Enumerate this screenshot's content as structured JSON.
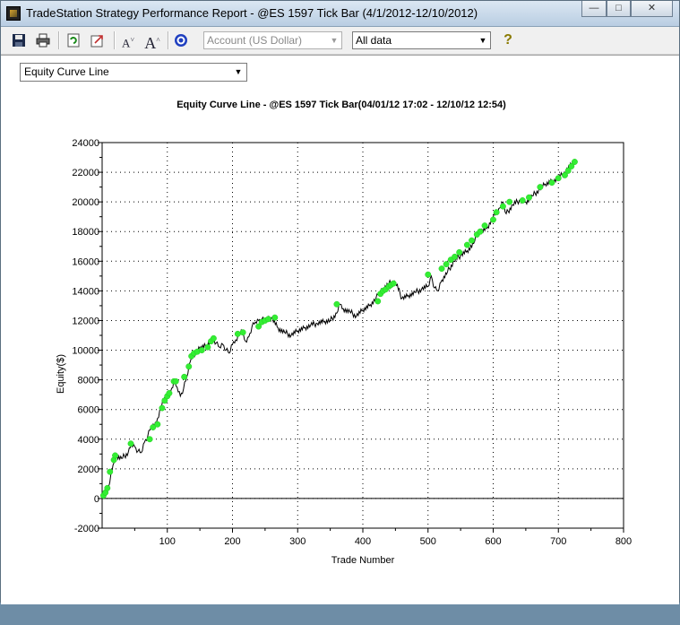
{
  "window": {
    "title": "TradeStation Strategy Performance Report - @ES 1597 Tick Bar (4/1/2012-12/10/2012)",
    "controls": {
      "minimize": "—",
      "maximize": "□",
      "close": "✕"
    }
  },
  "toolbar": {
    "icons": [
      "save-icon",
      "print-icon",
      "refresh-icon",
      "export-icon",
      "decrease-font-icon",
      "increase-font-icon",
      "target-icon",
      "help-icon"
    ],
    "account_select": {
      "value": "Account (US Dollar)",
      "disabled": true
    },
    "data_select": {
      "value": "All data"
    }
  },
  "view_select": {
    "value": "Equity Curve Line"
  },
  "chart_data": {
    "type": "line",
    "title": "Equity Curve Line - @ES 1597 Tick Bar(04/01/12 17:02 - 12/10/12 12:54)",
    "xlabel": "Trade Number",
    "ylabel": "Equity($)",
    "xlim": [
      0,
      800
    ],
    "ylim": [
      -2000,
      24000
    ],
    "xticks": [
      "100",
      "200",
      "300",
      "400",
      "500",
      "600",
      "700",
      "800"
    ],
    "yticks": [
      "-2000",
      "0",
      "2000",
      "4000",
      "6000",
      "8000",
      "10000",
      "12000",
      "14000",
      "16000",
      "18000",
      "20000",
      "22000",
      "24000"
    ],
    "grid": true,
    "line_color": "#000000",
    "marker_color": "#33ee33",
    "series": [
      {
        "x": [
          0,
          5,
          10,
          15,
          20,
          30,
          40,
          45,
          50,
          55,
          60,
          65,
          70,
          75,
          80,
          85,
          90,
          95,
          100,
          105,
          110,
          115,
          120,
          125,
          130,
          135,
          140,
          145,
          150,
          160,
          170,
          175,
          180,
          185,
          190,
          195,
          200,
          205,
          210,
          215,
          220,
          225,
          230,
          235,
          240,
          245,
          250,
          260,
          270,
          280,
          290,
          300,
          310,
          320,
          330,
          340,
          350,
          360,
          365,
          370,
          380,
          390,
          400,
          410,
          420,
          425,
          430,
          440,
          450,
          460,
          470,
          480,
          490,
          500,
          505,
          510,
          515,
          520,
          530,
          540,
          550,
          560,
          570,
          575,
          580,
          590,
          600,
          610,
          615,
          620,
          630,
          640,
          650,
          660,
          670,
          680,
          690,
          700,
          710,
          720,
          725
        ],
        "y": [
          0,
          400,
          800,
          1800,
          2900,
          2700,
          3100,
          3700,
          3500,
          3200,
          3100,
          3800,
          4200,
          4800,
          4900,
          5400,
          6200,
          6700,
          7000,
          7200,
          7900,
          7500,
          6900,
          7400,
          8200,
          9200,
          9700,
          9900,
          10100,
          10300,
          10800,
          10500,
          10200,
          10400,
          10000,
          9800,
          10400,
          10700,
          11100,
          11200,
          10600,
          10900,
          11600,
          11900,
          12000,
          12100,
          11900,
          12200,
          11500,
          11200,
          11000,
          11300,
          11500,
          11700,
          11800,
          11900,
          12000,
          12500,
          13100,
          12800,
          12600,
          12300,
          12700,
          13000,
          13500,
          13900,
          14100,
          14500,
          14600,
          13500,
          13700,
          13900,
          14100,
          14300,
          15000,
          14200,
          14000,
          14600,
          15300,
          16000,
          16400,
          16700,
          17200,
          17800,
          18000,
          18200,
          19000,
          19600,
          20000,
          19200,
          19800,
          20100,
          20000,
          20400,
          20800,
          21200,
          21400,
          21600,
          22000,
          22500,
          22800
        ]
      }
    ],
    "new_high_points": [
      [
        2,
        200
      ],
      [
        5,
        400
      ],
      [
        8,
        700
      ],
      [
        12,
        1800
      ],
      [
        18,
        2600
      ],
      [
        20,
        2900
      ],
      [
        44,
        3700
      ],
      [
        73,
        4000
      ],
      [
        78,
        4800
      ],
      [
        85,
        5000
      ],
      [
        92,
        6100
      ],
      [
        96,
        6600
      ],
      [
        100,
        6900
      ],
      [
        103,
        7100
      ],
      [
        110,
        7900
      ],
      [
        113,
        7900
      ],
      [
        126,
        8200
      ],
      [
        133,
        8900
      ],
      [
        137,
        9600
      ],
      [
        141,
        9800
      ],
      [
        146,
        9900
      ],
      [
        153,
        10000
      ],
      [
        162,
        10200
      ],
      [
        167,
        10600
      ],
      [
        171,
        10800
      ],
      [
        208,
        11100
      ],
      [
        216,
        11200
      ],
      [
        240,
        11600
      ],
      [
        245,
        11900
      ],
      [
        250,
        12000
      ],
      [
        255,
        12100
      ],
      [
        265,
        12200
      ],
      [
        360,
        13100
      ],
      [
        423,
        13300
      ],
      [
        427,
        13800
      ],
      [
        431,
        14000
      ],
      [
        435,
        14100
      ],
      [
        440,
        14300
      ],
      [
        443,
        14400
      ],
      [
        447,
        14500
      ],
      [
        500,
        15100
      ],
      [
        521,
        15500
      ],
      [
        528,
        15800
      ],
      [
        535,
        16100
      ],
      [
        541,
        16300
      ],
      [
        548,
        16600
      ],
      [
        560,
        17100
      ],
      [
        567,
        17400
      ],
      [
        575,
        17800
      ],
      [
        580,
        18000
      ],
      [
        587,
        18400
      ],
      [
        600,
        18800
      ],
      [
        605,
        19300
      ],
      [
        615,
        19700
      ],
      [
        625,
        20000
      ],
      [
        645,
        20100
      ],
      [
        655,
        20300
      ],
      [
        672,
        21000
      ],
      [
        690,
        21300
      ],
      [
        700,
        21600
      ],
      [
        710,
        21800
      ],
      [
        715,
        22100
      ],
      [
        720,
        22400
      ],
      [
        725,
        22700
      ]
    ]
  }
}
